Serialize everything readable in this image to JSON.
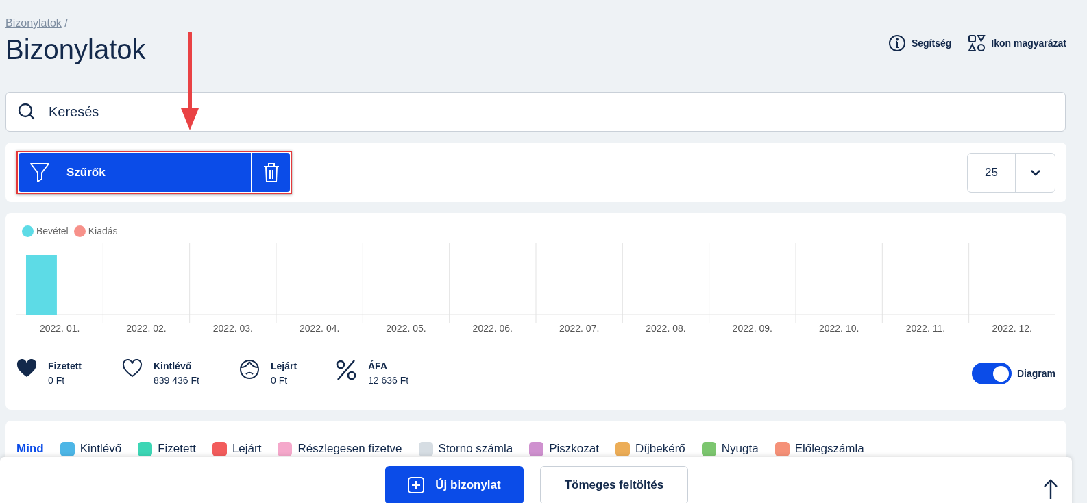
{
  "breadcrumb": {
    "link": "Bizonylatok",
    "separator": "/"
  },
  "title": "Bizonylatok",
  "header_links": [
    {
      "kind": "info",
      "label": "Segítség"
    },
    {
      "kind": "shapes",
      "label": "Ikon magyarázat"
    }
  ],
  "search": {
    "placeholder": "Keresés"
  },
  "filters": {
    "label": "Szűrők",
    "page_size": "25"
  },
  "chart": {
    "legend": [
      {
        "name": "Bevétel",
        "color": "#5ddbe6"
      },
      {
        "name": "Kiadás",
        "color": "#f7918a"
      }
    ],
    "x_labels": [
      "2022. 01.",
      "2022. 02.",
      "2022. 03.",
      "2022. 04.",
      "2022. 05.",
      "2022. 06.",
      "2022. 07.",
      "2022. 08.",
      "2022. 09.",
      "2022. 10.",
      "2022. 11.",
      "2022. 12."
    ]
  },
  "stats": [
    {
      "kind": "paid",
      "label": "Fizetett",
      "value": "0 Ft"
    },
    {
      "kind": "outstanding",
      "label": "Kintlévő",
      "value": "839 436 Ft"
    },
    {
      "kind": "overdue",
      "label": "Lejárt",
      "value": "0 Ft"
    },
    {
      "kind": "vat",
      "label": "ÁFA",
      "value": "12 636 Ft"
    }
  ],
  "diagram_toggle": {
    "label": "Diagram",
    "on": true
  },
  "status_filters": [
    {
      "label": "Mind",
      "selected": true
    },
    {
      "label": "Kintlévő",
      "color": "#4db6e6",
      "selected": false
    },
    {
      "label": "Fizetett",
      "color": "#3dd6b5",
      "selected": false
    },
    {
      "label": "Lejárt",
      "color": "#f25c5c",
      "selected": false
    },
    {
      "label": "Részlegesen fizetve",
      "color": "#f5a8cb",
      "selected": false
    },
    {
      "label": "Storno számla",
      "color": "#d6dde3",
      "selected": false
    },
    {
      "label": "Piszkozat",
      "color": "#cf91cf",
      "selected": false
    },
    {
      "label": "Díjbekérő",
      "color": "#ecad57",
      "selected": false
    },
    {
      "label": "Nyugta",
      "color": "#7cc66f",
      "selected": false
    },
    {
      "label": "Előlegszámla",
      "color": "#f59178",
      "selected": false
    }
  ],
  "bottom_buttons": [
    {
      "kind": "primary",
      "label": "Új bizonylat"
    },
    {
      "kind": "secondary",
      "label": "Tömeges feltöltés"
    }
  ]
}
